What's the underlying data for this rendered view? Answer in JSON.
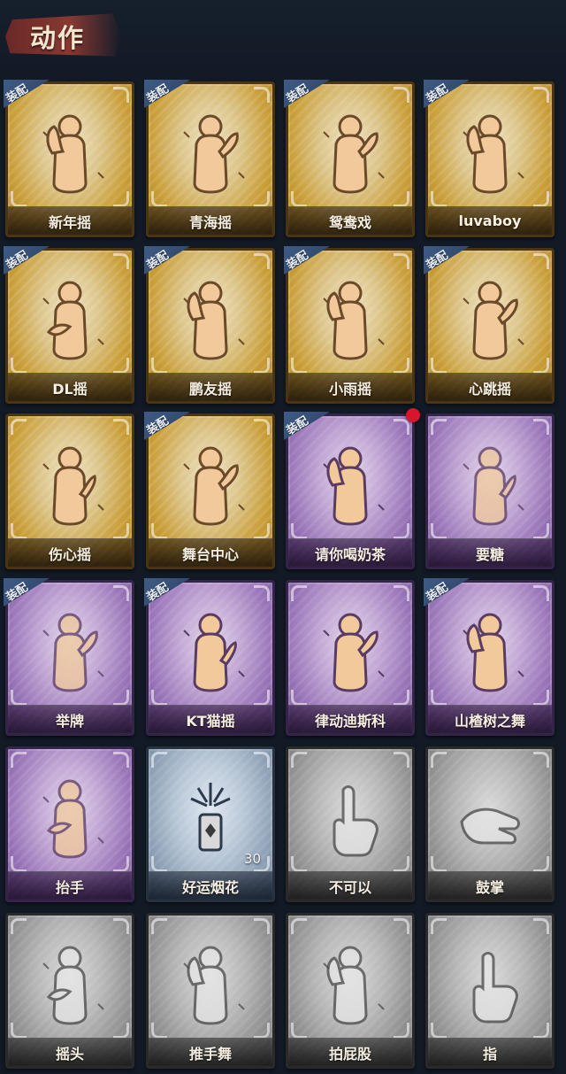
{
  "header": {
    "title": "动作"
  },
  "equip_badge": "装配",
  "cards": [
    {
      "label": "新年摇",
      "theme": "gold",
      "equipped": true,
      "icon": "figure-clap-icon"
    },
    {
      "label": "青海摇",
      "theme": "gold",
      "equipped": true,
      "icon": "figure-shake-icon"
    },
    {
      "label": "鸳鸯戏",
      "theme": "gold",
      "equipped": true,
      "icon": "figure-dance-icon"
    },
    {
      "label": "luvaboy",
      "theme": "gold",
      "equipped": true,
      "icon": "figure-pose-icon"
    },
    {
      "label": "DL摇",
      "theme": "gold",
      "equipped": true,
      "icon": "figure-arm-up-icon"
    },
    {
      "label": "鹏友摇",
      "theme": "gold",
      "equipped": true,
      "icon": "figure-wave-icon"
    },
    {
      "label": "小雨摇",
      "theme": "gold",
      "equipped": true,
      "icon": "figure-rain-icon"
    },
    {
      "label": "心跳摇",
      "theme": "gold",
      "equipped": true,
      "icon": "figure-heartbeat-icon"
    },
    {
      "label": "伤心摇",
      "theme": "gold",
      "equipped": false,
      "icon": "figure-heart-hands-icon"
    },
    {
      "label": "舞台中心",
      "theme": "gold",
      "equipped": true,
      "icon": "figure-stage-icon"
    },
    {
      "label": "请你喝奶茶",
      "theme": "purple",
      "equipped": true,
      "icon": "figure-sign-icon",
      "new": true
    },
    {
      "label": "要糖",
      "theme": "purple",
      "equipped": false,
      "icon": "figure-beg-icon"
    },
    {
      "label": "举牌",
      "theme": "purple",
      "equipped": true,
      "icon": "figure-hold-sign-icon"
    },
    {
      "label": "KT猫摇",
      "theme": "purple",
      "equipped": true,
      "icon": "figure-cat-icon"
    },
    {
      "label": "律动迪斯科",
      "theme": "purple",
      "equipped": false,
      "icon": "figure-disco-icon"
    },
    {
      "label": "山楂树之舞",
      "theme": "purple",
      "equipped": true,
      "icon": "figure-hawthorn-icon"
    },
    {
      "label": "抬手",
      "theme": "purple",
      "equipped": false,
      "icon": "figure-raise-hand-icon"
    },
    {
      "label": "好运烟花",
      "theme": "blue",
      "equipped": false,
      "icon": "firework-icon",
      "count": "30"
    },
    {
      "label": "不可以",
      "theme": "gray",
      "equipped": false,
      "icon": "finger-no-icon"
    },
    {
      "label": "鼓掌",
      "theme": "gray",
      "equipped": false,
      "icon": "clap-hands-icon"
    },
    {
      "label": "摇头",
      "theme": "gray",
      "equipped": false,
      "icon": "figure-head-shake-icon"
    },
    {
      "label": "推手舞",
      "theme": "gray",
      "equipped": false,
      "icon": "figure-push-icon"
    },
    {
      "label": "拍屁股",
      "theme": "gray",
      "equipped": false,
      "icon": "figure-slap-icon"
    },
    {
      "label": "指",
      "theme": "gray",
      "equipped": false,
      "icon": "pointing-hand-icon"
    }
  ]
}
